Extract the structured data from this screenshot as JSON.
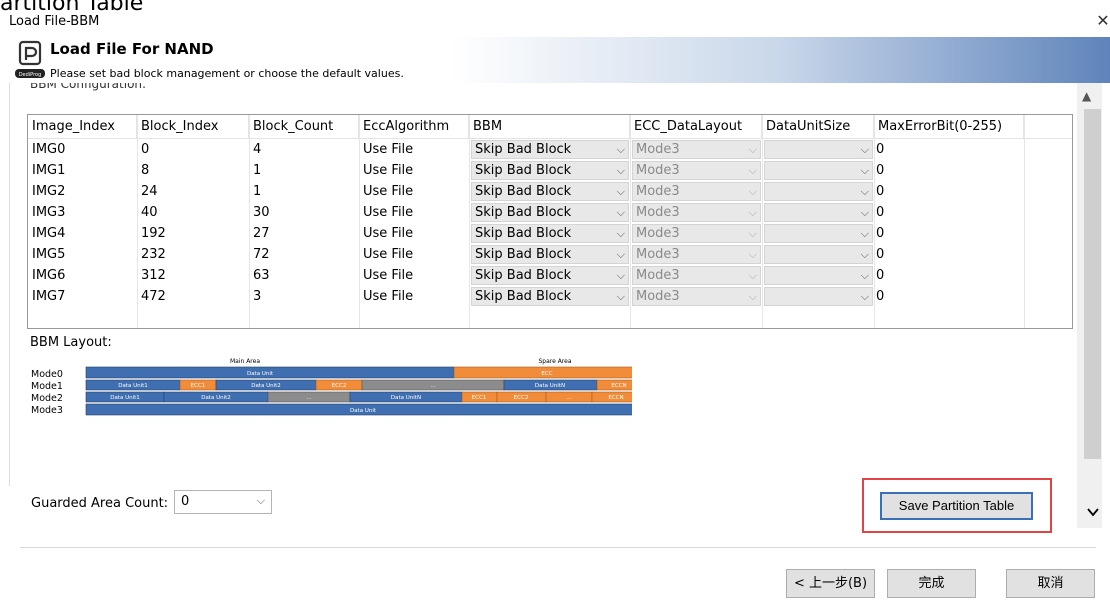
{
  "window": {
    "overflow_text": "artition Table",
    "title": "Load File-BBM",
    "close_glyph": "✕"
  },
  "header": {
    "title": "Load File For NAND",
    "subtitle": "Please set bad block management or choose the default values.",
    "logo_text": "DediProg"
  },
  "config": {
    "label": "BBM Configuration:",
    "columns": [
      "Image_Index",
      "Block_Index",
      "Block_Count",
      "EccAlgorithm",
      "BBM",
      "ECC_DataLayout",
      "DataUnitSize",
      "MaxErrorBit(0-255)"
    ],
    "rows": [
      {
        "image": "IMG0",
        "block_index": "0",
        "block_count": "4",
        "ecc": "Use File",
        "bbm": "Skip Bad Block",
        "layout": "Mode3",
        "unit_size": "",
        "max_error": "0"
      },
      {
        "image": "IMG1",
        "block_index": "8",
        "block_count": "1",
        "ecc": "Use File",
        "bbm": "Skip Bad Block",
        "layout": "Mode3",
        "unit_size": "",
        "max_error": "0"
      },
      {
        "image": "IMG2",
        "block_index": "24",
        "block_count": "1",
        "ecc": "Use File",
        "bbm": "Skip Bad Block",
        "layout": "Mode3",
        "unit_size": "",
        "max_error": "0"
      },
      {
        "image": "IMG3",
        "block_index": "40",
        "block_count": "30",
        "ecc": "Use File",
        "bbm": "Skip Bad Block",
        "layout": "Mode3",
        "unit_size": "",
        "max_error": "0"
      },
      {
        "image": "IMG4",
        "block_index": "192",
        "block_count": "27",
        "ecc": "Use File",
        "bbm": "Skip Bad Block",
        "layout": "Mode3",
        "unit_size": "",
        "max_error": "0"
      },
      {
        "image": "IMG5",
        "block_index": "232",
        "block_count": "72",
        "ecc": "Use File",
        "bbm": "Skip Bad Block",
        "layout": "Mode3",
        "unit_size": "",
        "max_error": "0"
      },
      {
        "image": "IMG6",
        "block_index": "312",
        "block_count": "63",
        "ecc": "Use File",
        "bbm": "Skip Bad Block",
        "layout": "Mode3",
        "unit_size": "",
        "max_error": "0"
      },
      {
        "image": "IMG7",
        "block_index": "472",
        "block_count": "3",
        "ecc": "Use File",
        "bbm": "Skip Bad Block",
        "layout": "Mode3",
        "unit_size": "",
        "max_error": "0"
      }
    ]
  },
  "bbm_layout": {
    "label": "BBM Layout:",
    "main_area": "Main Area",
    "spare_area": "Spare Area",
    "modes": [
      "Mode0",
      "Mode1",
      "Mode2",
      "Mode3"
    ],
    "mode0": {
      "data": "Data Unit",
      "ecc": "ECC"
    },
    "mode1": {
      "d1": "Data Unit1",
      "e1": "ECC1",
      "d2": "Data Unit2",
      "e2": "ECC2",
      "dots": "...",
      "dn": "Data UnitN",
      "en": "ECCN"
    },
    "mode2": {
      "d1": "Data Unit1",
      "d2": "Data Unit2",
      "dots": "...",
      "dn": "Data UnitN",
      "e1": "ECC1",
      "e2": "ECC2",
      "edots": "...",
      "en": "ECCN"
    },
    "mode3": {
      "data": "Data Unit"
    },
    "colors": {
      "blue": "#3f6fb0",
      "orange": "#f18d3a",
      "gray": "#8c8c8c"
    }
  },
  "guarded": {
    "label": "Guarded Area Count:",
    "value": "0"
  },
  "save_button": "Save Partition Table",
  "footer": {
    "back": "< 上一步(B)",
    "finish": "完成",
    "cancel": "取消"
  },
  "icons": {
    "scroll_up": "chevron-up-icon",
    "scroll_down": "chevron-down-icon",
    "dropdown": "chevron-down-icon"
  }
}
